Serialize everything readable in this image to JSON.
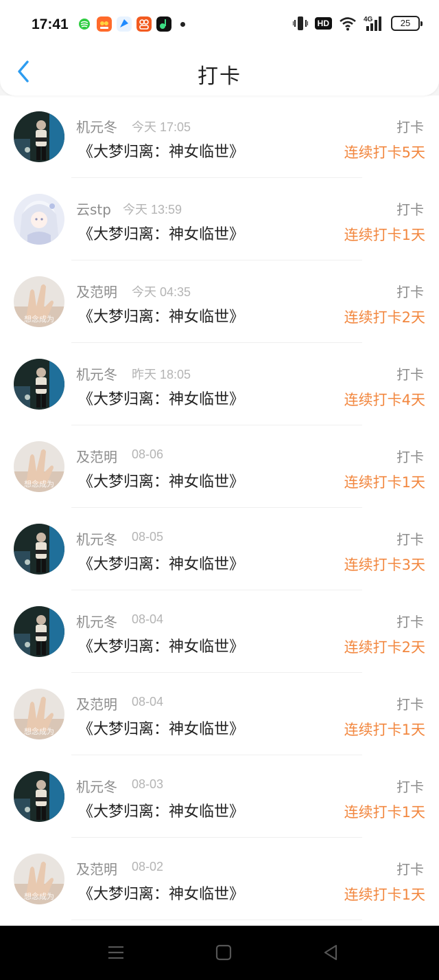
{
  "status_bar": {
    "time": "17:41",
    "hd_badge": "HD",
    "network": "4G",
    "battery": "25"
  },
  "header": {
    "title": "打卡"
  },
  "entries": [
    {
      "name": "机元冬",
      "time": "今天 17:05",
      "book": "《大梦归离：神女临世》",
      "type": "打卡",
      "streak": "连续打卡5天",
      "avatar": "dark"
    },
    {
      "name": "云stp",
      "time": "今天 13:59",
      "book": "《大梦归离：神女临世》",
      "type": "打卡",
      "streak": "连续打卡1天",
      "avatar": "anime"
    },
    {
      "name": "及范明",
      "time": "今天 04:35",
      "book": "《大梦归离：神女临世》",
      "type": "打卡",
      "streak": "连续打卡2天",
      "avatar": "hand"
    },
    {
      "name": "机元冬",
      "time": "昨天 18:05",
      "book": "《大梦归离：神女临世》",
      "type": "打卡",
      "streak": "连续打卡4天",
      "avatar": "dark"
    },
    {
      "name": "及范明",
      "time": "08-06",
      "book": "《大梦归离：神女临世》",
      "type": "打卡",
      "streak": "连续打卡1天",
      "avatar": "hand"
    },
    {
      "name": "机元冬",
      "time": "08-05",
      "book": "《大梦归离：神女临世》",
      "type": "打卡",
      "streak": "连续打卡3天",
      "avatar": "dark"
    },
    {
      "name": "机元冬",
      "time": "08-04",
      "book": "《大梦归离：神女临世》",
      "type": "打卡",
      "streak": "连续打卡2天",
      "avatar": "dark"
    },
    {
      "name": "及范明",
      "time": "08-04",
      "book": "《大梦归离：神女临世》",
      "type": "打卡",
      "streak": "连续打卡1天",
      "avatar": "hand"
    },
    {
      "name": "机元冬",
      "time": "08-03",
      "book": "《大梦归离：神女临世》",
      "type": "打卡",
      "streak": "连续打卡1天",
      "avatar": "dark"
    },
    {
      "name": "及范明",
      "time": "08-02",
      "book": "《大梦归离：神女临世》",
      "type": "打卡",
      "streak": "连续打卡1天",
      "avatar": "hand"
    }
  ],
  "colors": {
    "accent_blue": "#2d9cf0",
    "streak_orange": "#f2873f"
  },
  "icons": [
    "back-chevron-icon",
    "menu-icon",
    "home-icon",
    "back-triangle-icon"
  ]
}
